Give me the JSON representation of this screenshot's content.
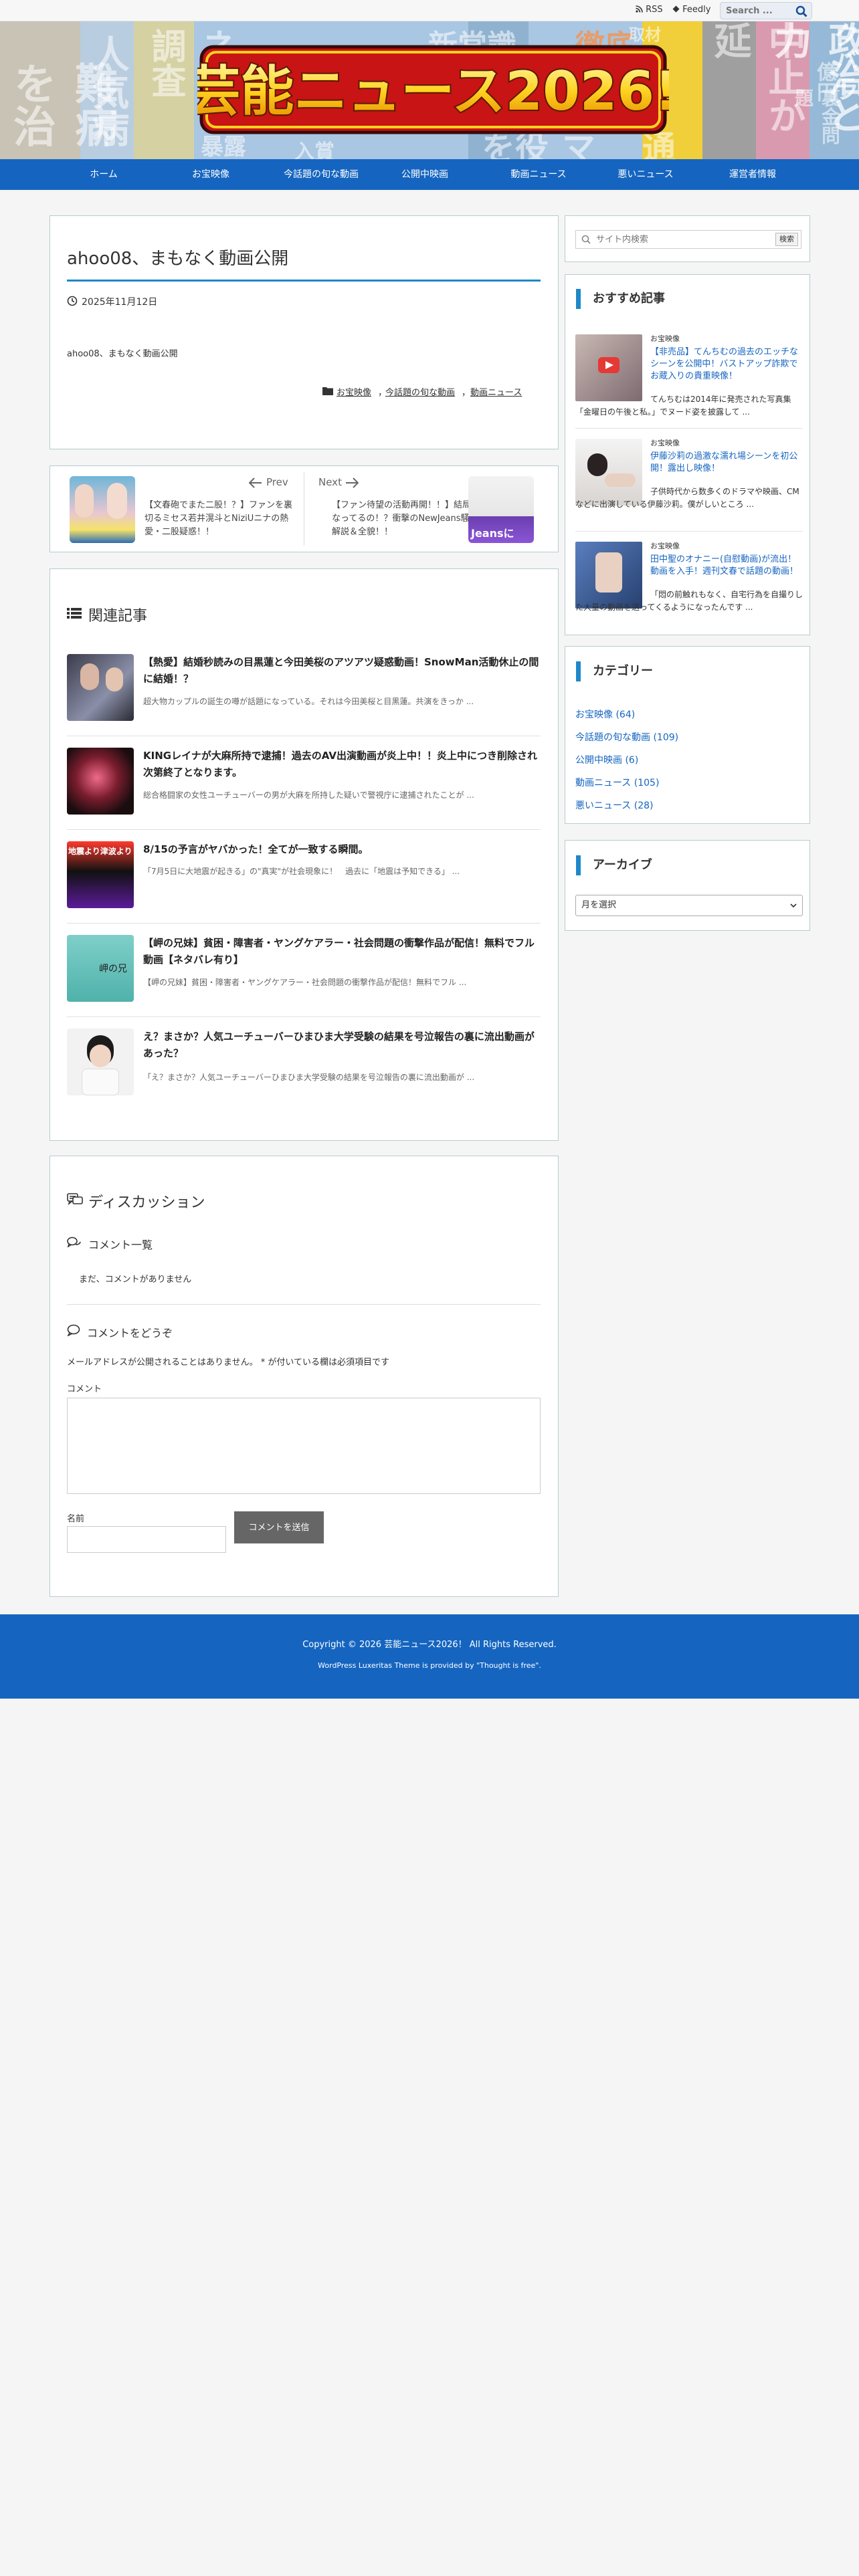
{
  "topbar": {
    "rss": "RSS",
    "feedly": "Feedly",
    "search_placeholder": "Search ..."
  },
  "banner": {
    "logo_text": "芸能ニュース2026!",
    "background_words": [
      "難病を治",
      "人気病",
      "ネット調査",
      "新常識",
      "徹底",
      "中止か延",
      "政治と力",
      "クバラ",
      "億円",
      "裏金問題",
      "暴露",
      "取材",
      "入賞",
      "を役",
      "マ",
      "通"
    ]
  },
  "nav": [
    "ホーム",
    "お宝映像",
    "今話題の旬な動画",
    "公開中映画",
    "動画ニュース",
    "悪いニュース",
    "運営者情報"
  ],
  "post": {
    "title": "ahoo08、まもなく動画公開",
    "date": "2025年11月12日",
    "body": "ahoo08、まもなく動画公開",
    "categories": [
      "お宝映像",
      "今話題の旬な動画",
      "動画ニュース"
    ],
    "category_sep": "，"
  },
  "prevnext": {
    "prev_label": "Prev",
    "next_label": "Next",
    "prev_text": "【文春砲でまた二股！？】ファンを裏切るミセス若井滉斗とNiziUニナの熱愛・二股疑惑！！",
    "next_text": "【ファン待望の活動再開！！】結局どうなってるの！？衝撃のNewJeans騒動の解説＆全貌！！",
    "next_thumb_caption": "Jeansに"
  },
  "related": {
    "heading": "関連記事",
    "items": [
      {
        "title": "【熱愛】結婚秒読みの目黒蓮と今田美桜のアツアツ疑惑動画！SnowMan活動休止の間に結婚！？",
        "excerpt": "超大物カップルの誕生の噂が話題になっている。それは今田美桜と目黒蓮。共演をきっか ..."
      },
      {
        "title": "KINGレイナが大麻所持で逮捕！過去のAV出演動画が炎上中！！炎上中につき削除され次第終了となります。",
        "excerpt": "総合格闘家の女性ユーチューバーの男が大麻を所持した疑いで警視庁に逮捕されたことが ..."
      },
      {
        "title": "8/15の予言がヤバかった！全てが一致する瞬間。",
        "excerpt": "「7月5日に大地震が起きる」の\"真実\"が社会現象に！　過去に「地震は予知できる」 ..."
      },
      {
        "title": "【岬の兄妹】貧困・障害者・ヤングケアラー・社会問題の衝撃作品が配信！無料でフル動画【ネタバレ有り】",
        "excerpt": "【岬の兄妹】貧困・障害者・ヤングケアラー・社会問題の衝撃作品が配信！無料でフル ..."
      },
      {
        "title": "え？まさか？人気ユーチューバーひまひま大学受験の結果を号泣報告の裏に流出動画があった？",
        "excerpt": "「え？まさか？人気ユーチューバーひまひま大学受験の結果を号泣報告の裏に流出動画が ..."
      }
    ],
    "thumb_texts": [
      "",
      "",
      "地震より津波より",
      "岬の兄",
      ""
    ]
  },
  "discussion": {
    "heading": "ディスカッション",
    "list_heading": "コメント一覧",
    "no_comments": "まだ、コメントがありません",
    "form_heading": "コメントをどうぞ",
    "notice": "メールアドレスが公開されることはありません。 * が付いている欄は必須項目です",
    "comment_label": "コメント",
    "name_label": "名前",
    "submit_label": "コメントを送信"
  },
  "sidebar": {
    "search_placeholder": "サイト内検索",
    "search_button": "検索",
    "recommended_heading": "おすすめ記事",
    "recommended": [
      {
        "category": "お宝映像",
        "title": "【非売品】てんちむの過去のエッチなシーンを公開中！バストアップ詐欺でお蔵入りの貴重映像！",
        "excerpt": "てんちむは2014年に発売された写真集「金曜日の午後と私。」でヌード姿を披露して ..."
      },
      {
        "category": "お宝映像",
        "title": "伊藤沙莉の過激な濡れ場シーンを初公開！露出し映像！",
        "excerpt": "子供時代から数多くのドラマや映画、CMなどに出演している伊藤沙莉。僕がしいところ ..."
      },
      {
        "category": "お宝映像",
        "title": "田中聖のオナニー(自慰動画)が流出！動画を入手！週刊文春で話題の動画！",
        "excerpt": "「悶の前触れもなく、自宅行為を自撮りした大量の動画を送ってくるようになったんです ..."
      }
    ],
    "categories_heading": "カテゴリー",
    "categories": [
      {
        "name": "お宝映像",
        "count": "(64)"
      },
      {
        "name": "今話題の旬な動画",
        "count": "(109)"
      },
      {
        "name": "公開中映画",
        "count": "(6)"
      },
      {
        "name": "動画ニュース",
        "count": "(105)"
      },
      {
        "name": "悪いニュース",
        "count": "(28)"
      }
    ],
    "archive_heading": "アーカイブ",
    "archive_select": "月を選択"
  },
  "footer": {
    "copyright": "Copyright © 2026 芸能ニュース2026！ All Rights Reserved.",
    "credit": "WordPress Luxeritas Theme is provided by \"Thought is free\"."
  },
  "colors": {
    "accent": "#1565c0",
    "rule": "#1e88c8",
    "border": "#b9cbcf"
  }
}
